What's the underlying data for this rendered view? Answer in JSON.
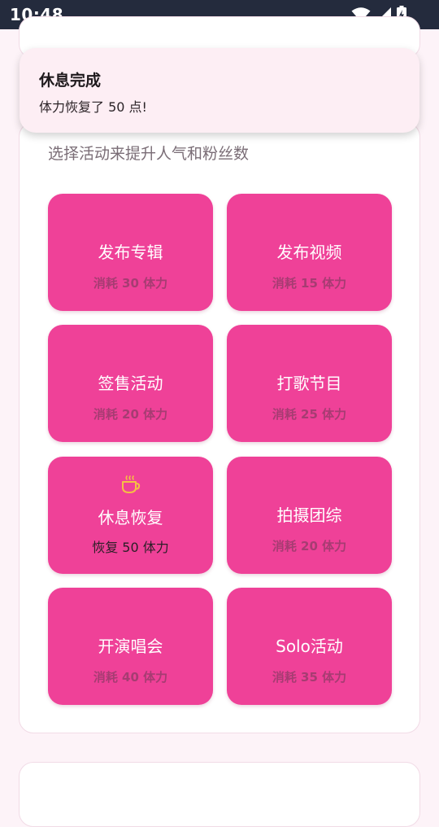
{
  "status_bar": {
    "time": "10:48",
    "icons": [
      "wifi-icon",
      "cell-signal-icon",
      "battery-charging-icon"
    ]
  },
  "toast": {
    "title": "休息完成",
    "message": "体力恢复了 50 点!"
  },
  "activities": {
    "subtitle": "选择活动来提升人气和粉丝数",
    "buttons": [
      {
        "label": "发布专辑",
        "cost": "消耗 30 体力"
      },
      {
        "label": "发布视频",
        "cost": "消耗 15 体力"
      },
      {
        "label": "签售活动",
        "cost": "消耗 20 体力"
      },
      {
        "label": "打歌节目",
        "cost": "消耗 25 体力"
      },
      {
        "label": "休息恢复",
        "cost": "恢复 50 体力",
        "icon": "coffee-cup-icon"
      },
      {
        "label": "拍摄团综",
        "cost": "消耗 20 体力"
      },
      {
        "label": "开演唱会",
        "cost": "消耗 40 体力"
      },
      {
        "label": "Solo活动",
        "cost": "消耗 35 体力"
      }
    ]
  },
  "colors": {
    "accent": "#ef4198",
    "status_bar": "#242b3d",
    "background": "#fdf3f8",
    "rest_icon": "#f5c043"
  }
}
